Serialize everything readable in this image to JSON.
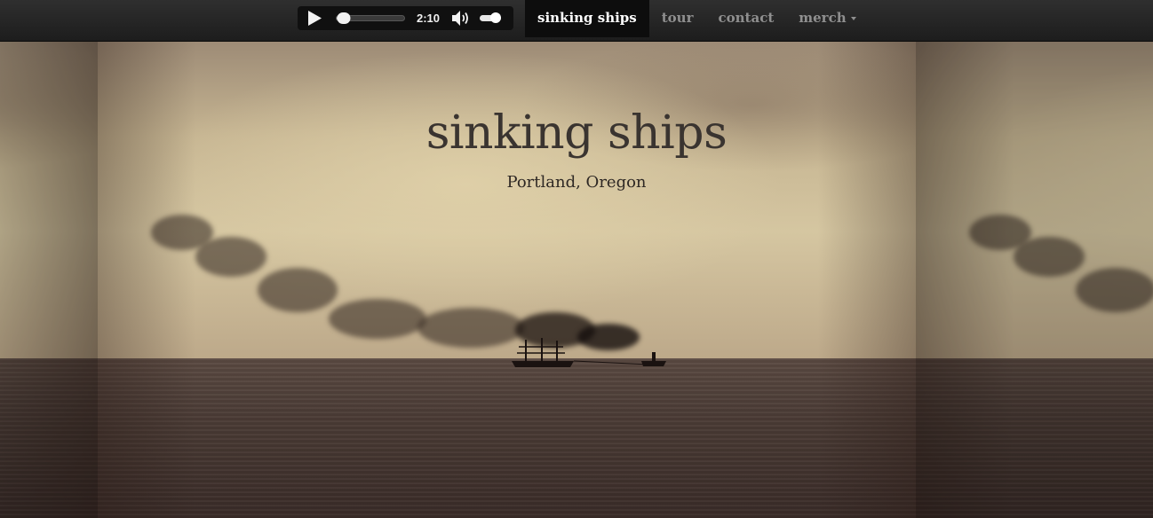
{
  "player": {
    "time": "2:10",
    "progress": 0.1,
    "volume": 0.75,
    "icons": {
      "play": "play-icon",
      "volume": "volume-icon"
    }
  },
  "nav": {
    "items": [
      {
        "label": "sinking ships",
        "active": true
      },
      {
        "label": "tour",
        "active": false
      },
      {
        "label": "contact",
        "active": false
      },
      {
        "label": "merch",
        "active": false,
        "dropdown": true
      }
    ]
  },
  "hero": {
    "title": "sinking ships",
    "location": "Portland, Oregon"
  },
  "colors": {
    "navbar": "#262626",
    "nav_active_bg": "#0d0d0d",
    "nav_text": "#8f8f8f",
    "title_text": "#3a3430"
  }
}
